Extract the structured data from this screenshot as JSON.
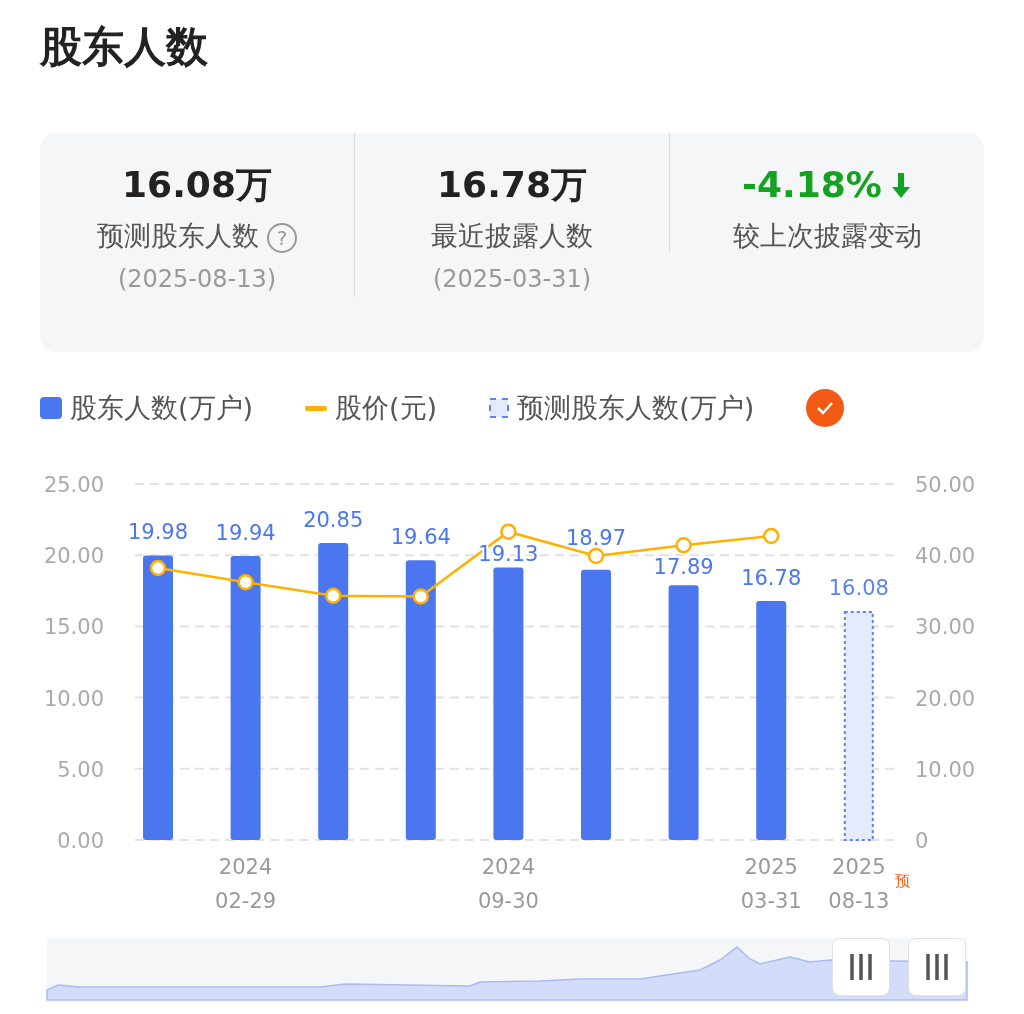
{
  "title": "股东人数",
  "summary": [
    {
      "value": "16.08万",
      "label": "预测股东人数",
      "help": "?",
      "date": "(2025-08-13)",
      "down_arrow": false
    },
    {
      "value": "16.78万",
      "label": "最近披露人数",
      "date": "(2025-03-31)",
      "down_arrow": false
    },
    {
      "value": "-4.18%",
      "label": "较上次披露变动",
      "down_arrow": true
    }
  ],
  "legend_toggle": {
    "checked": true
  },
  "chart": {
    "chart_data": {
      "type": "bar",
      "categories": [
        null,
        "2024 02-29",
        null,
        null,
        "2024 09-30",
        null,
        null,
        "2025 03-31",
        "2025 08-13"
      ],
      "ylim": [
        0,
        25
      ],
      "yticks": [
        {
          "value": 0,
          "label": "0.00"
        },
        {
          "value": 5,
          "label": "5.00"
        },
        {
          "value": 10,
          "label": "10.00"
        },
        {
          "value": 15,
          "label": "15.00"
        },
        {
          "value": 20,
          "label": "20.00"
        },
        {
          "value": 25,
          "label": "25.00"
        }
      ],
      "y2lim": [
        0,
        50
      ],
      "y2ticks": [
        {
          "value": 0,
          "label": "0"
        },
        {
          "value": 10,
          "label": "10.00"
        },
        {
          "value": 20,
          "label": "20.00"
        },
        {
          "value": 30,
          "label": "30.00"
        },
        {
          "value": 40,
          "label": "40.00"
        },
        {
          "value": 50,
          "label": "50.00"
        }
      ],
      "series": [
        {
          "name": "股东人数(万户)",
          "color": "#4a76f0",
          "values": [
            19.98,
            19.94,
            20.85,
            19.64,
            19.13,
            18.97,
            17.89,
            16.78,
            null
          ],
          "value_labels": [
            "19.98",
            "19.94",
            "20.85",
            "19.64",
            "19.13",
            "18.97",
            "17.89",
            "16.78",
            null
          ]
        },
        {
          "name": "股价(元)",
          "type": "line",
          "axis": "y2",
          "marker": true,
          "color": "#ffb000",
          "values": [
            38.2,
            36.2,
            34.3,
            34.2,
            43.3,
            39.9,
            41.4,
            42.7,
            null
          ]
        },
        {
          "name": "预测股东人数(万户)",
          "color": "#5b84f2",
          "values": [
            null,
            null,
            null,
            null,
            null,
            null,
            null,
            null,
            16.08
          ],
          "value_labels": [
            null,
            null,
            null,
            null,
            null,
            null,
            null,
            null,
            "16.08"
          ]
        }
      ],
      "grid": true
    },
    "forecast_mark": "预"
  }
}
